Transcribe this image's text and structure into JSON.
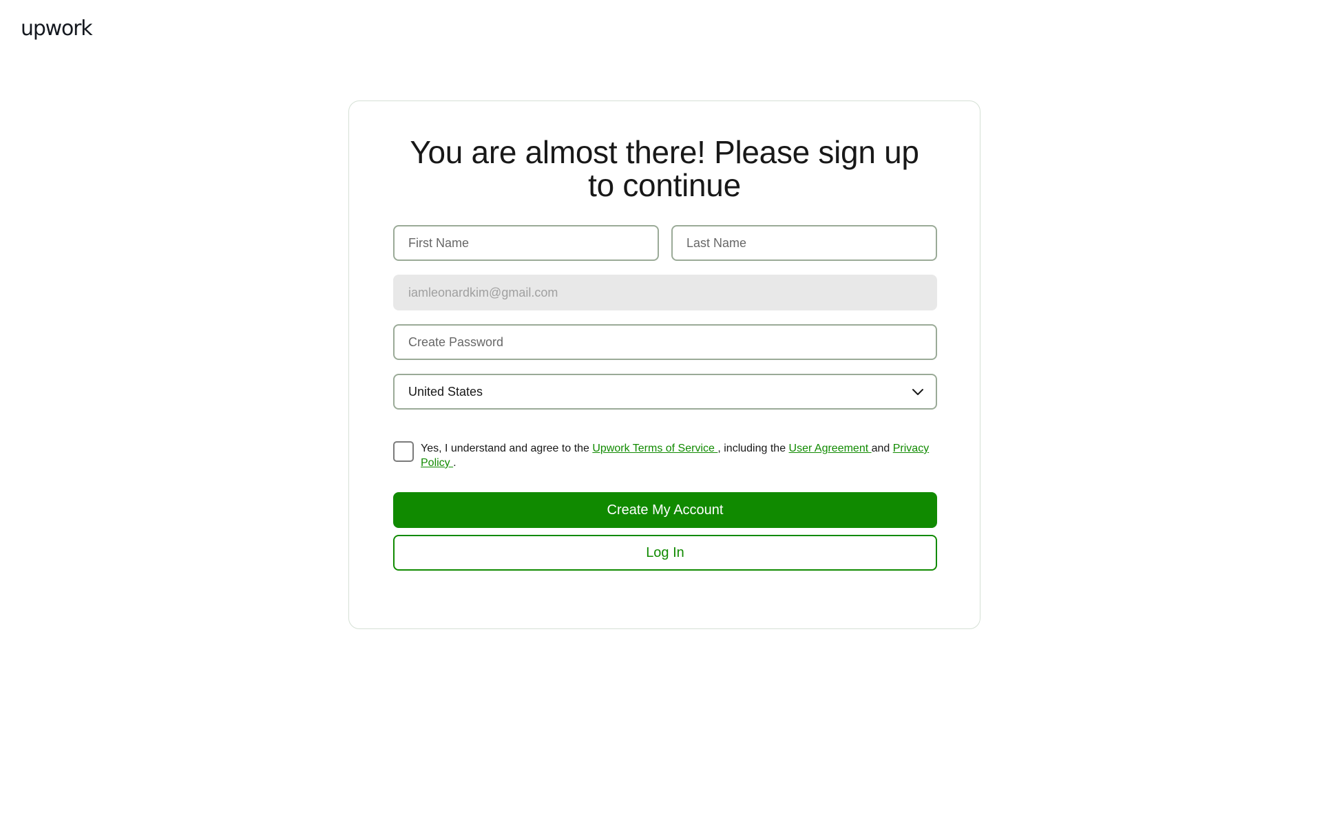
{
  "header": {
    "logo_text": "upwork"
  },
  "signup": {
    "title": "You are almost there! Please sign up to continue",
    "first_name": {
      "placeholder": "First Name",
      "value": ""
    },
    "last_name": {
      "placeholder": "Last Name",
      "value": ""
    },
    "email": {
      "placeholder": "iamleonardkim@gmail.com",
      "value": ""
    },
    "password": {
      "placeholder": "Create Password",
      "value": ""
    },
    "country": {
      "selected": "United States",
      "icon": "chevron-down-icon"
    },
    "terms": {
      "checked": false,
      "text_1": "Yes, I understand and agree to the ",
      "tos_link": "Upwork Terms of Service ",
      "text_2": ", including the ",
      "user_agreement_link": "User Agreement ",
      "text_3": "and ",
      "privacy_link": "Privacy Policy ",
      "text_4": "."
    },
    "create_button": "Create My Account",
    "login_button": "Log In"
  },
  "colors": {
    "brand_green": "#108a00",
    "border": "#9aaa97",
    "disabled_bg": "#e8e8e8"
  }
}
